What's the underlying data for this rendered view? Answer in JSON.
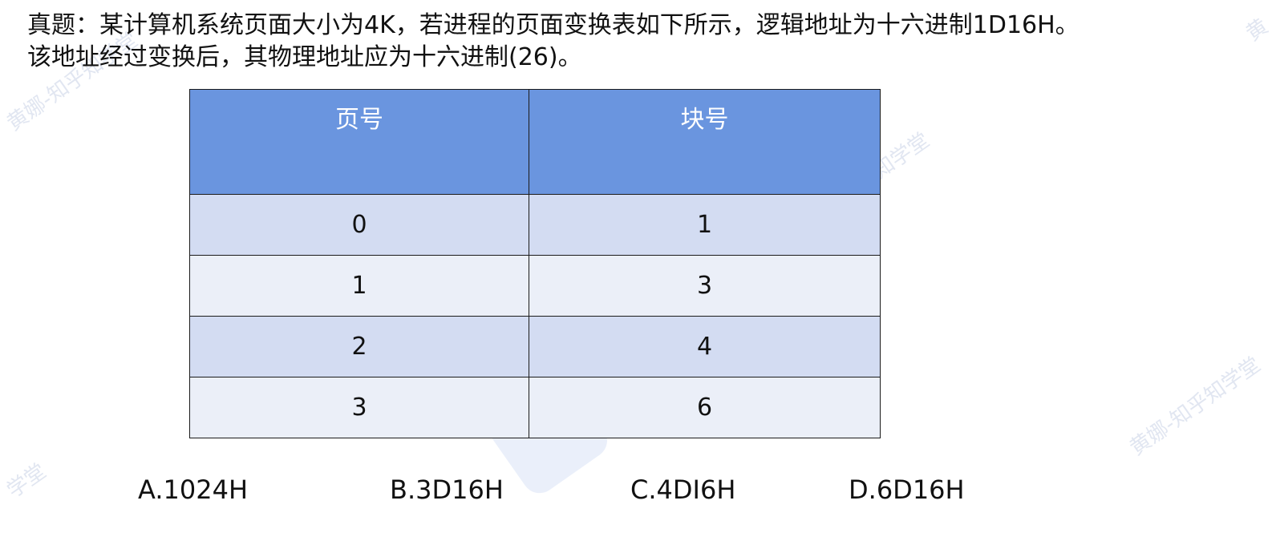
{
  "question": {
    "line1": "真题：某计算机系统页面大小为4K，若进程的页面变换表如下所示，逻辑地址为十六进制1D16H。",
    "line2": "该地址经过变换后，其物理地址应为十六进制(26)。"
  },
  "table": {
    "headers": [
      "页号",
      "块号"
    ],
    "rows": [
      [
        "0",
        "1"
      ],
      [
        "1",
        "3"
      ],
      [
        "2",
        "4"
      ],
      [
        "3",
        "6"
      ]
    ]
  },
  "options": [
    "A.1024H",
    "B.3D16H",
    "C.4DI6H",
    "D.6D16H"
  ],
  "watermark": {
    "text_a": "黄娜-知乎知学堂",
    "text_b": "知学堂",
    "text_c": "黄娜-知乎知学堂",
    "text_d": "黄娜-知乎知学堂",
    "text_e": "学堂",
    "text_f": "黄"
  },
  "colors": {
    "header_bg": "#6a95df",
    "row_dark": "#d3dcf2",
    "row_light": "#ebeff8"
  }
}
